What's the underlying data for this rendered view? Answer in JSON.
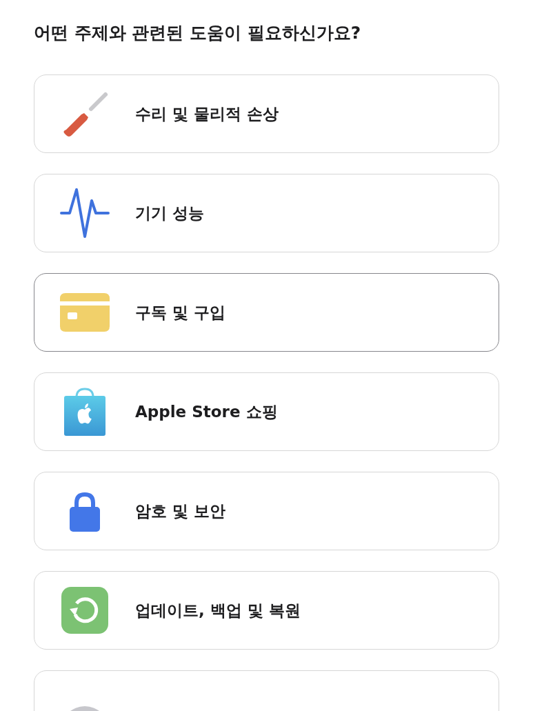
{
  "heading": "어떤 주제와 관련된 도움이 필요하신가요?",
  "topics": [
    {
      "kind": "screwdriver",
      "label": "수리 및 물리적 손상",
      "selected": false
    },
    {
      "kind": "pulse",
      "label": "기기 성능",
      "selected": false
    },
    {
      "kind": "card",
      "label": "구독 및 구입",
      "selected": true
    },
    {
      "kind": "bag",
      "label": "Apple Store 쇼핑",
      "selected": false
    },
    {
      "kind": "lock",
      "label": "암호 및 보안",
      "selected": false
    },
    {
      "kind": "restore",
      "label": "업데이트, 백업 및 복원",
      "selected": false
    },
    {
      "kind": "circle",
      "selected": false
    }
  ]
}
